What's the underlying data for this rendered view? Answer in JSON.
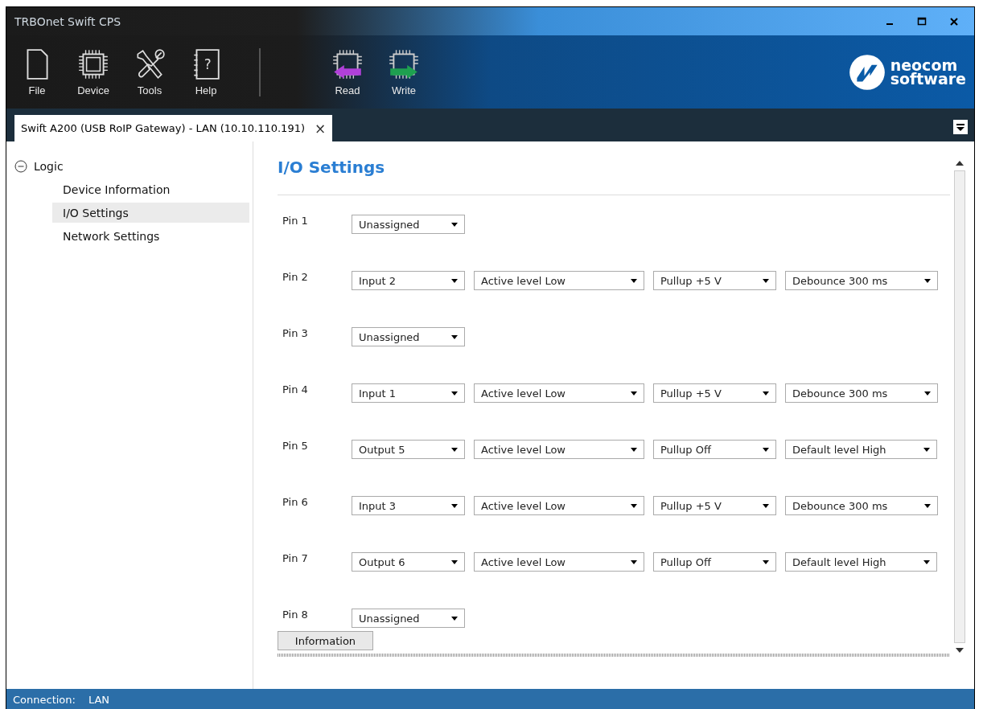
{
  "window": {
    "title": "TRBOnet Swift CPS"
  },
  "toolbar": {
    "groups": [
      [
        {
          "label": "File",
          "kind": "file"
        },
        {
          "label": "Device",
          "kind": "chip"
        },
        {
          "label": "Tools",
          "kind": "tools"
        },
        {
          "label": "Help",
          "kind": "help",
          "glyph": "?"
        }
      ],
      [
        {
          "label": "Read",
          "kind": "read"
        },
        {
          "label": "Write",
          "kind": "write"
        }
      ]
    ],
    "logo": {
      "line1": "neocom",
      "line2": "software"
    }
  },
  "tabs": [
    {
      "label": "Swift A200 (USB RoIP Gateway) - LAN (10.10.110.191)",
      "selected": true,
      "close": "×"
    }
  ],
  "sidebar": {
    "items": [
      {
        "label": "Logic",
        "expanded": true,
        "selected": false,
        "children": [
          {
            "label": "Device Information",
            "selected": false
          },
          {
            "label": "I/O Settings",
            "selected": true
          },
          {
            "label": "Network Settings",
            "selected": false
          }
        ]
      }
    ]
  },
  "content": {
    "title": "I/O Settings",
    "pins": [
      {
        "label": "Pin 1",
        "fields": [
          "Unassigned"
        ]
      },
      {
        "label": "Pin 2",
        "fields": [
          "Input 2",
          "Active level Low",
          "Pullup +5 V",
          "Debounce 300 ms"
        ]
      },
      {
        "label": "Pin 3",
        "fields": [
          "Unassigned"
        ]
      },
      {
        "label": "Pin 4",
        "fields": [
          "Input 1",
          "Active level Low",
          "Pullup +5 V",
          "Debounce 300 ms"
        ]
      },
      {
        "label": "Pin 5",
        "fields": [
          "Output 5",
          "Active level Low",
          "Pullup Off",
          "Default level High"
        ]
      },
      {
        "label": "Pin 6",
        "fields": [
          "Input 3",
          "Active level Low",
          "Pullup +5 V",
          "Debounce 300 ms"
        ]
      },
      {
        "label": "Pin 7",
        "fields": [
          "Output 6",
          "Active level Low",
          "Pullup Off",
          "Default level High"
        ]
      },
      {
        "label": "Pin 8",
        "fields": [
          "Unassigned"
        ]
      }
    ],
    "button": "Information"
  },
  "status_bar": {
    "label": "Connection:",
    "value": "LAN"
  }
}
